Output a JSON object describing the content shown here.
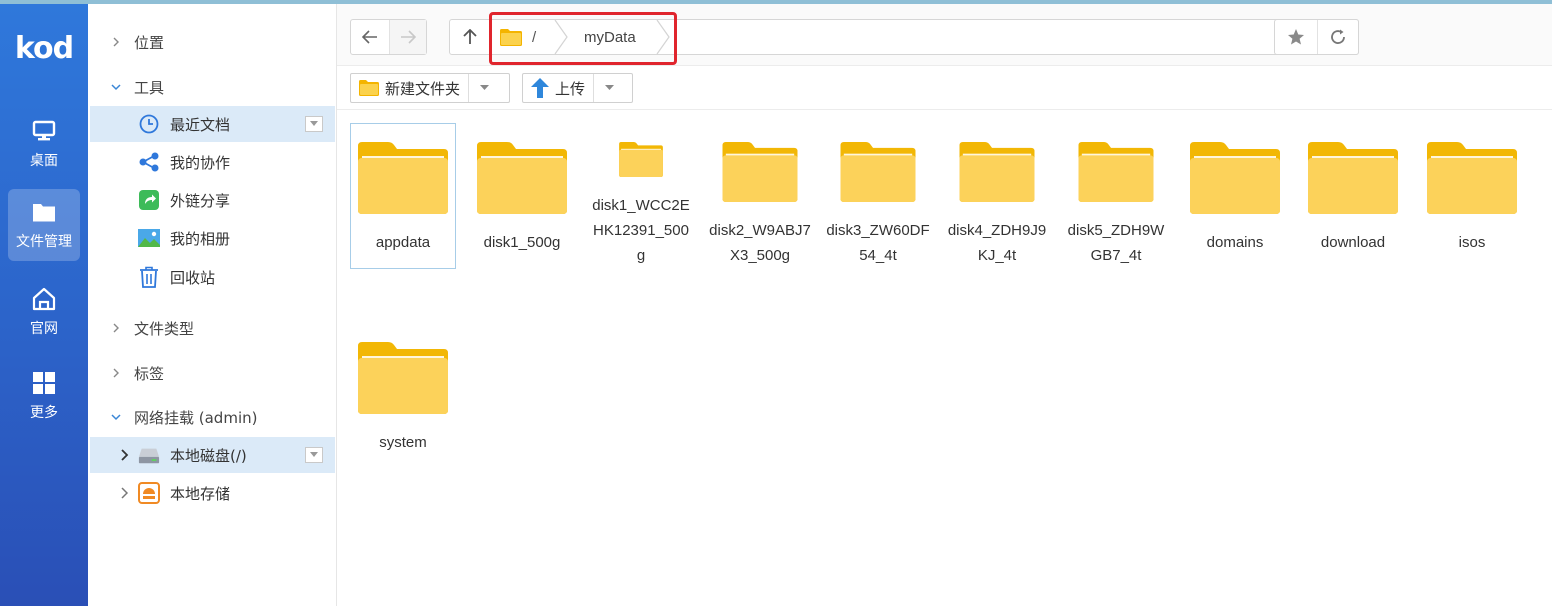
{
  "app": {
    "logo": "kod"
  },
  "rail": {
    "items": [
      {
        "label": "桌面",
        "icon": "monitor-icon"
      },
      {
        "label": "文件管理",
        "icon": "folder-icon",
        "active": true
      },
      {
        "label": "官网",
        "icon": "home-icon"
      },
      {
        "label": "更多",
        "icon": "grid-icon"
      }
    ]
  },
  "sidebar": {
    "groups": {
      "location": "位置",
      "tools": "工具",
      "file_types": "文件类型",
      "tags": "标签",
      "network_mount": "网络挂载 (admin)"
    },
    "tools": [
      {
        "label": "最近文档",
        "icon": "clock-icon"
      },
      {
        "label": "我的协作",
        "icon": "share-nodes-icon"
      },
      {
        "label": "外链分享",
        "icon": "external-share-icon"
      },
      {
        "label": "我的相册",
        "icon": "photo-icon"
      },
      {
        "label": "回收站",
        "icon": "trash-icon"
      }
    ],
    "mounts": [
      {
        "label": "本地磁盘(/)",
        "icon": "disk-icon"
      },
      {
        "label": "本地存储",
        "icon": "storage-icon"
      }
    ]
  },
  "toolbar": {
    "breadcrumb_root": "/",
    "breadcrumb_current": "myData"
  },
  "actions": {
    "new_folder": "新建文件夹",
    "upload": "上传"
  },
  "files": [
    {
      "name": "appdata",
      "selected": true
    },
    {
      "name": "disk1_500g"
    },
    {
      "name": "disk1_WCC2EHK12391_500g"
    },
    {
      "name": "disk2_W9ABJ7X3_500g"
    },
    {
      "name": "disk3_ZW60DF54_4t"
    },
    {
      "name": "disk4_ZDH9J9KJ_4t"
    },
    {
      "name": "disk5_ZDH9WGB7_4t"
    },
    {
      "name": "domains"
    },
    {
      "name": "download"
    },
    {
      "name": "isos"
    },
    {
      "name": "system"
    }
  ],
  "colors": {
    "rail_top": "#2f78db",
    "rail_bottom": "#2a4fb6",
    "selection": "#dbeaf8",
    "folder": "#f9c83a",
    "highlight_box": "#e0252d"
  }
}
